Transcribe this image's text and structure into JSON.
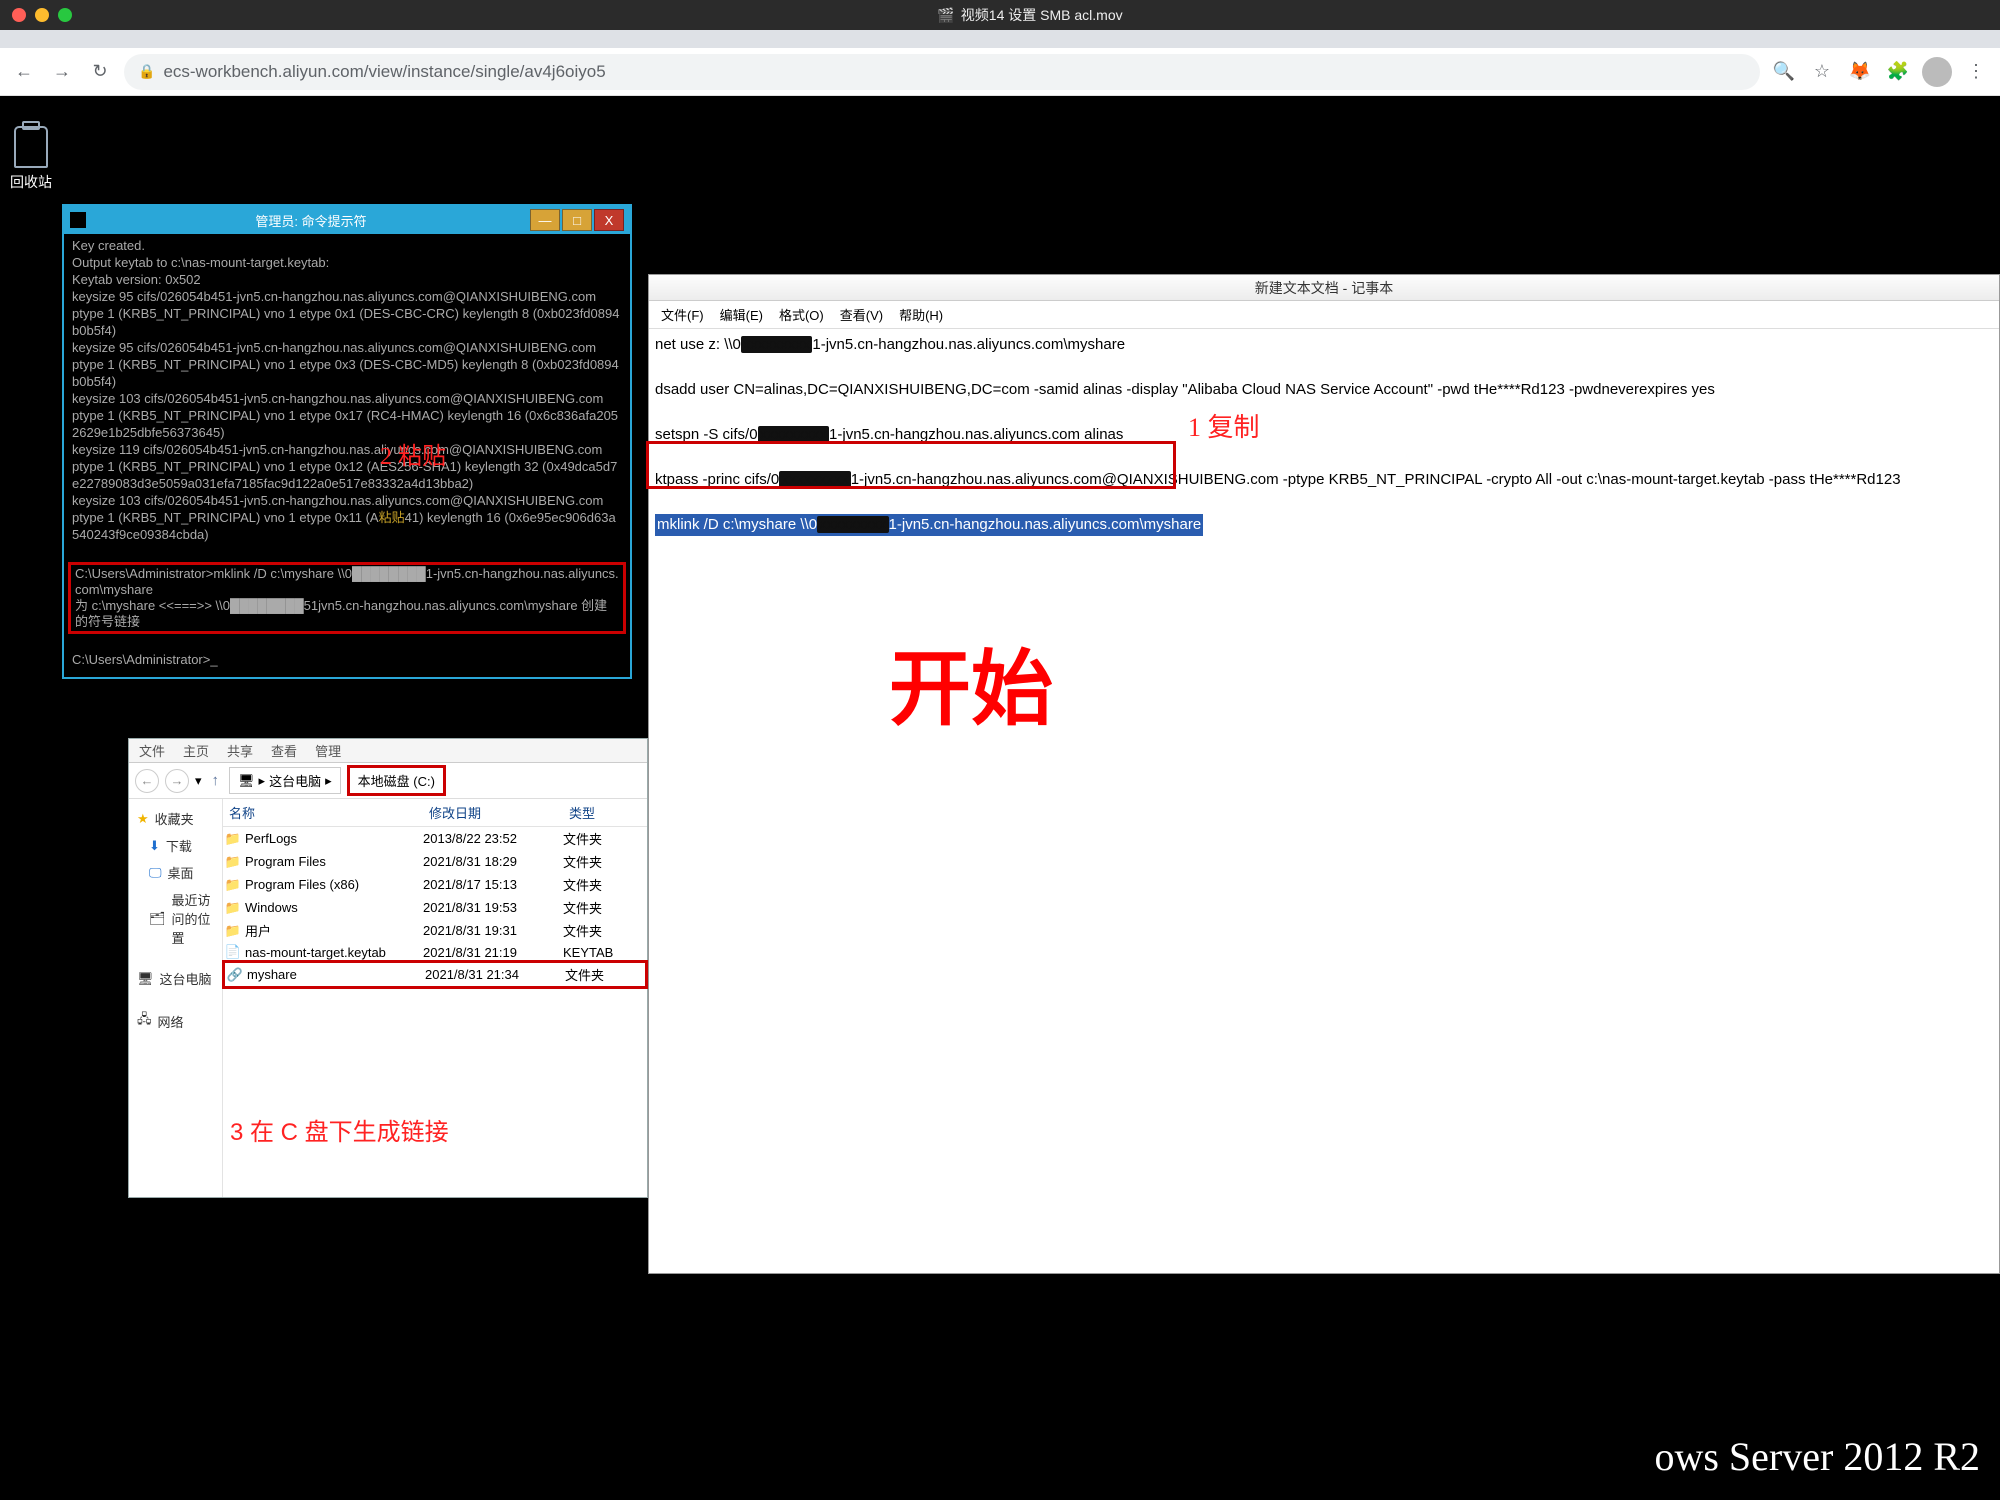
{
  "macbar": {
    "title": "视频14 设置 SMB acl.mov"
  },
  "chrome": {
    "url": "ecs-workbench.aliyun.com/view/instance/single/av4j6oiyo5"
  },
  "desktop": {
    "icon_label": "回收站",
    "watermark": "ows Server 2012 R2"
  },
  "cmd": {
    "title": "管理员: 命令提示符",
    "buttons": {
      "min": "—",
      "max": "□",
      "close": "X"
    },
    "lines_top": "Key created.\nOutput keytab to c:\\nas-mount-target.keytab:\nKeytab version: 0x502\nkeysize 95 cifs/026054b451-jvn5.cn-hangzhou.nas.aliyuncs.com@QIANXISHUIBENG.com\nptype 1 (KRB5_NT_PRINCIPAL) vno 1 etype 0x1 (DES-CBC-CRC) keylength 8 (0xb023fd0894b0b5f4)\nkeysize 95 cifs/026054b451-jvn5.cn-hangzhou.nas.aliyuncs.com@QIANXISHUIBENG.com\nptype 1 (KRB5_NT_PRINCIPAL) vno 1 etype 0x3 (DES-CBC-MD5) keylength 8 (0xb023fd0894b0b5f4)\nkeysize 103 cifs/026054b451-jvn5.cn-hangzhou.nas.aliyuncs.com@QIANXISHUIBENG.com\nptype 1 (KRB5_NT_PRINCIPAL) vno 1 etype 0x17 (RC4-HMAC) keylength 16 (0x6c836afa2052629e1b25dbfe56373645)\nkeysize 119 cifs/026054b451-jvn5.cn-hangzhou.nas.aliyuncs.com@QIANXISHUIBENG.com\nptype 1 (KRB5_NT_PRINCIPAL) vno 1 etype 0x12 (AES256-SHA1) keylength 32 (0x49dca5d7e22789083d3e5059a031efa7185fac9d122a0e517e83332a4d13bba2)\nkeysize 103 cifs/026054b451-jvn5.cn-hangzhou.nas.aliyuncs.com@QIANXISHUIBENG.com\nptype 1 (KRB5_NT_PRINCIPAL) vno 1 etype 0x11 (A",
    "paste_frag": "粘贴",
    "paste_cont": "41) keylength 16 (0x6e95ec906d63a540243f9ce09384cbda)",
    "box_line1": "C:\\Users\\Administrator>mklink /D c:\\myshare \\\\0████████1-jvn5.cn-hangzhou.nas.aliyuncs.com\\myshare",
    "box_line2": "为 c:\\myshare <<===>> \\\\0████████51jvn5.cn-hangzhou.nas.aliyuncs.com\\myshare 创建的符号链接",
    "after": "C:\\Users\\Administrator>_"
  },
  "annotations": {
    "a2": "2 粘贴",
    "a1": "1 复制",
    "a3": "3 在 C 盘下生成链接",
    "start": "开始"
  },
  "notepad": {
    "title": "新建文本文档 - 记事本",
    "menu": [
      "文件(F)",
      "编辑(E)",
      "格式(O)",
      "查看(V)",
      "帮助(H)"
    ],
    "l1a": "net use z: \\\\0",
    "l1b": "1-jvn5.cn-hangzhou.nas.aliyuncs.com\\myshare",
    "l2": "dsadd user CN=alinas,DC=QIANXISHUIBENG,DC=com -samid alinas -display \"Alibaba Cloud NAS Service Account\" -pwd tHe****Rd123 -pwdneverexpires yes",
    "l3a": "setspn -S cifs/0",
    "l3b": "1-jvn5.cn-hangzhou.nas.aliyuncs.com alinas",
    "l4a": "ktpass -princ cifs/0",
    "l4b": "1-jvn5.cn-hangzhou.nas.aliyuncs.com@QIANXISHUIBENG.com -ptype KRB5_NT_PRINCIPAL -crypto All -out c:\\nas-mount-target.keytab -pass tHe****Rd123",
    "l5a": "mklink /D c:\\myshare \\\\0",
    "l5b": "1-jvn5.cn-hangzhou.nas.aliyuncs.com\\myshare"
  },
  "explorer": {
    "tabs": [
      "文件",
      "主页",
      "共享",
      "查看",
      "管理"
    ],
    "crumb1": "这台电脑",
    "crumb2": "本地磁盘 (C:)",
    "sidebar": {
      "fav": "收藏夹",
      "dl": "下载",
      "desktop": "桌面",
      "recent": "最近访问的位置",
      "pc": "这台电脑",
      "net": "网络"
    },
    "hdr_name": "名称",
    "hdr_date": "修改日期",
    "hdr_type": "类型",
    "rows": [
      {
        "name": "PerfLogs",
        "date": "2013/8/22 23:52",
        "type": "文件夹",
        "icon": "folder"
      },
      {
        "name": "Program Files",
        "date": "2021/8/31 18:29",
        "type": "文件夹",
        "icon": "folder"
      },
      {
        "name": "Program Files (x86)",
        "date": "2021/8/17 15:13",
        "type": "文件夹",
        "icon": "folder"
      },
      {
        "name": "Windows",
        "date": "2021/8/31 19:53",
        "type": "文件夹",
        "icon": "folder"
      },
      {
        "name": "用户",
        "date": "2021/8/31 19:31",
        "type": "文件夹",
        "icon": "folder"
      },
      {
        "name": "nas-mount-target.keytab",
        "date": "2021/8/31 21:19",
        "type": "KEYTAB",
        "icon": "file"
      },
      {
        "name": "myshare",
        "date": "2021/8/31 21:34",
        "type": "文件夹",
        "icon": "link"
      }
    ]
  }
}
